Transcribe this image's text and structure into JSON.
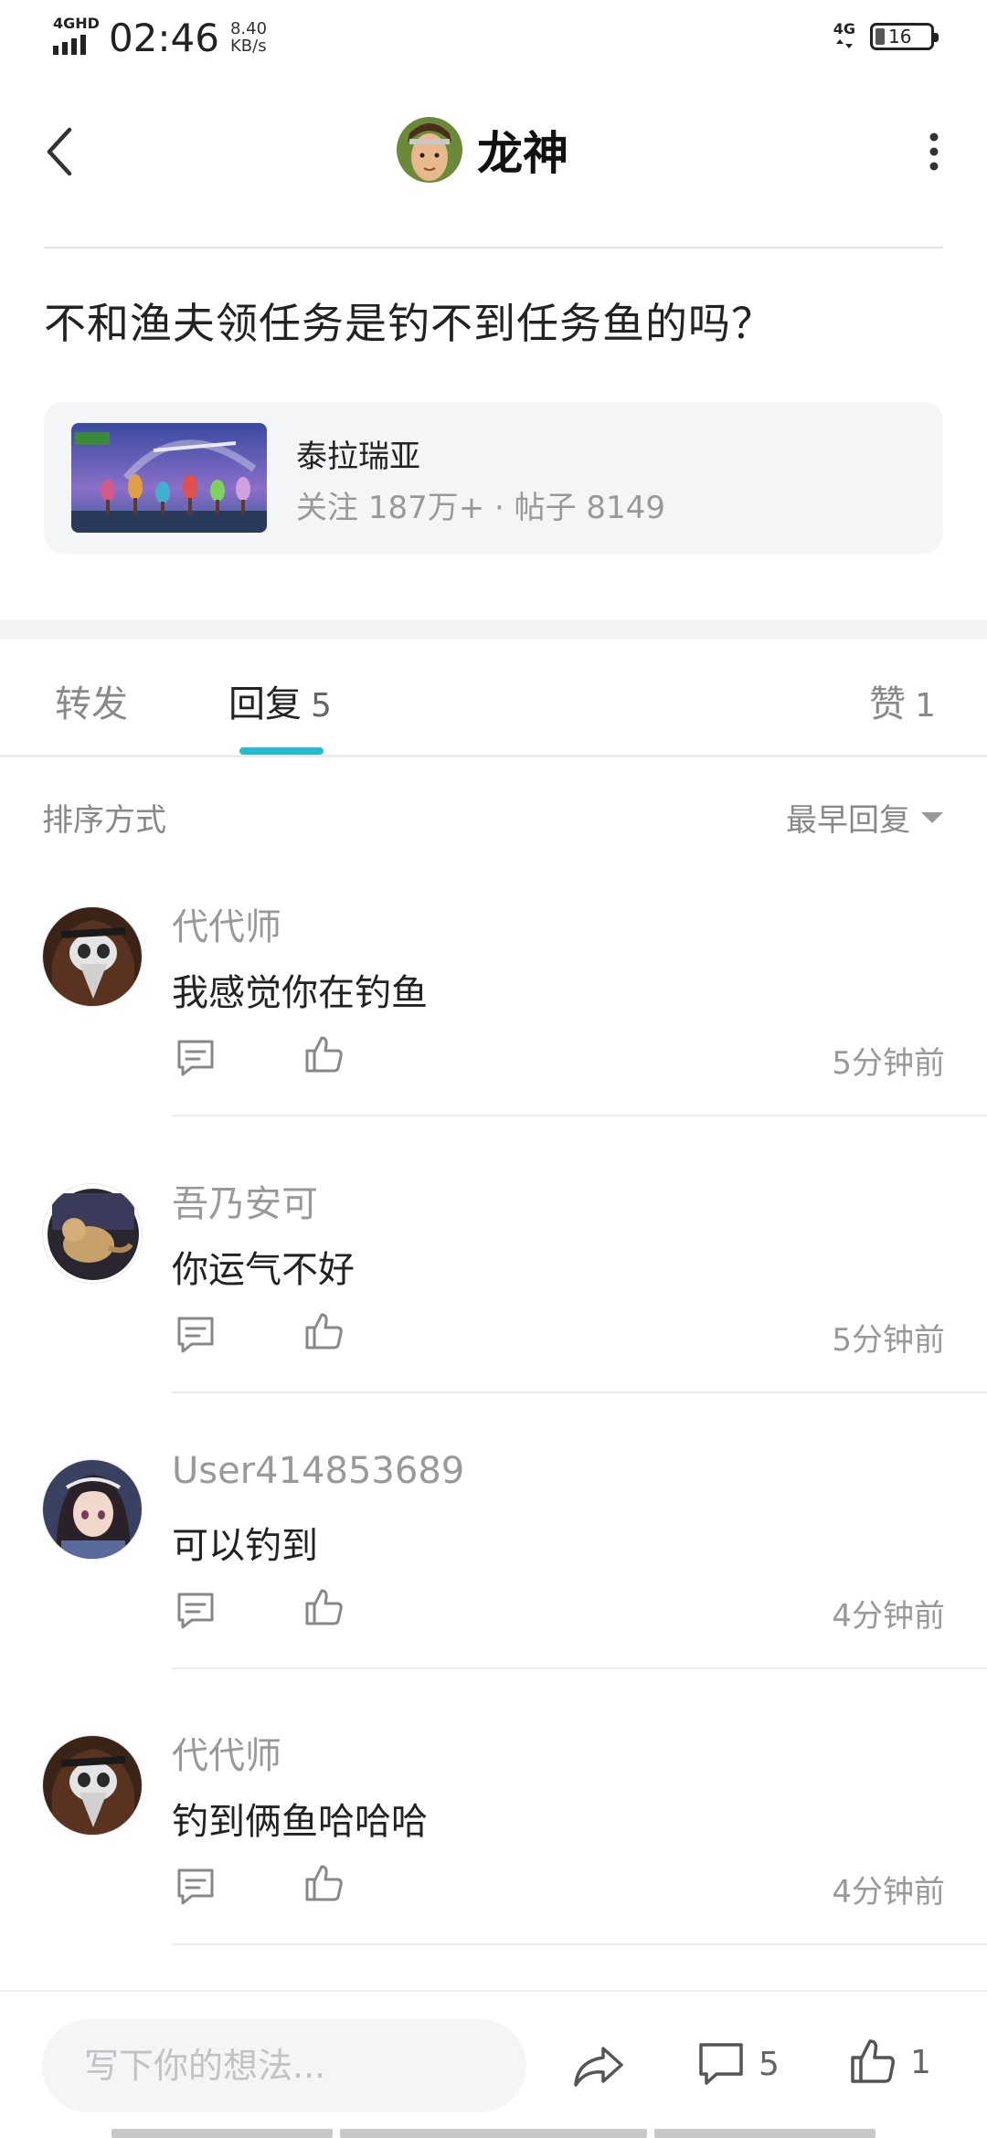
{
  "status_bar": {
    "network": "4GHD",
    "time": "02:46",
    "speed_value": "8.40",
    "speed_unit": "KB/s",
    "signal_right": "4G",
    "battery": "16"
  },
  "header": {
    "title": "龙神",
    "back_icon": "chevron-left-icon",
    "more_icon": "vertical-dots-icon"
  },
  "post": {
    "question": "不和渔夫领任务是钓不到任务鱼的吗？"
  },
  "forum": {
    "name": "泰拉瑞亚",
    "stats": "关注 187万+ · 帖子 8149"
  },
  "tabs": {
    "forward": "转发",
    "reply": "回复",
    "reply_count": "5",
    "like": "赞",
    "like_count": "1"
  },
  "sort": {
    "label": "排序方式",
    "selected": "最早回复"
  },
  "comments": [
    {
      "user": "代代师",
      "text": "我感觉你在钓鱼",
      "time": "5分钟前"
    },
    {
      "user": "吾乃安可",
      "text": "你运气不好",
      "time": "5分钟前"
    },
    {
      "user": "User414853689",
      "text": "可以钓到",
      "time": "4分钟前"
    },
    {
      "user": "代代师",
      "text": "钓到俩鱼哈哈哈",
      "time": "4分钟前"
    }
  ],
  "bottom_bar": {
    "placeholder": "写下你的想法...",
    "comment_count": "5",
    "like_count": "1"
  },
  "colors": {
    "accent": "#26bbd0",
    "muted_text": "#999999",
    "card_bg": "#f4f5f6"
  }
}
